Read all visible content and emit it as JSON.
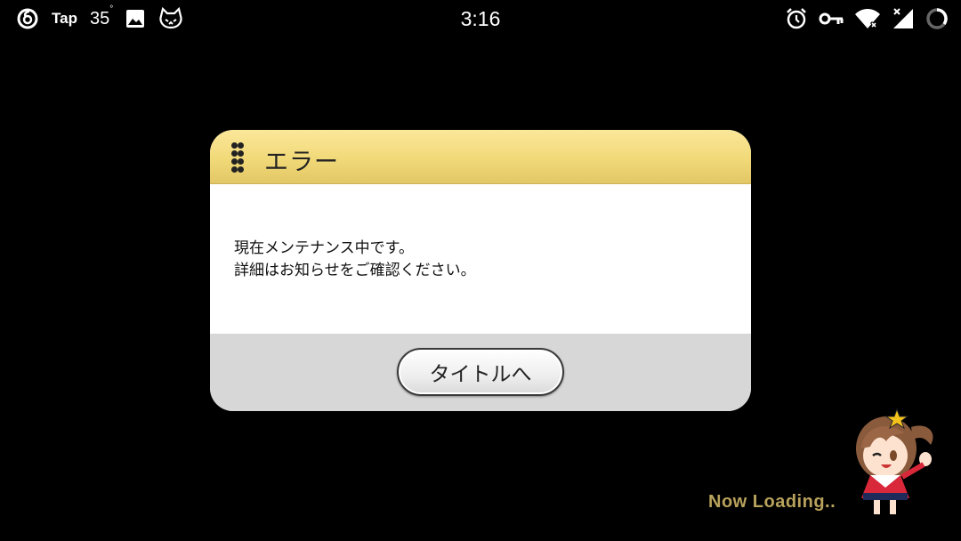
{
  "status_bar": {
    "left_icons": [
      "netease-music-icon",
      "image-icon",
      "cat-app-icon"
    ],
    "tap_label": "Tap",
    "temperature": "35",
    "temperature_unit": "°",
    "time": "3:16",
    "right_icons": [
      "alarm-icon",
      "vpn-key-icon",
      "wifi-icon",
      "cell-signal-icon",
      "loading-circle-icon"
    ]
  },
  "dialog": {
    "title": "エラー",
    "message_line1": "現在メンテナンス中です。",
    "message_line2": "詳細はお知らせをご確認ください。",
    "button_label": "タイトルへ"
  },
  "loading": {
    "text": "Now Loading.."
  },
  "colors": {
    "header_gold": "#f1d978",
    "footer_gray": "#d7d7d7",
    "loading_text": "#b8a25c"
  }
}
